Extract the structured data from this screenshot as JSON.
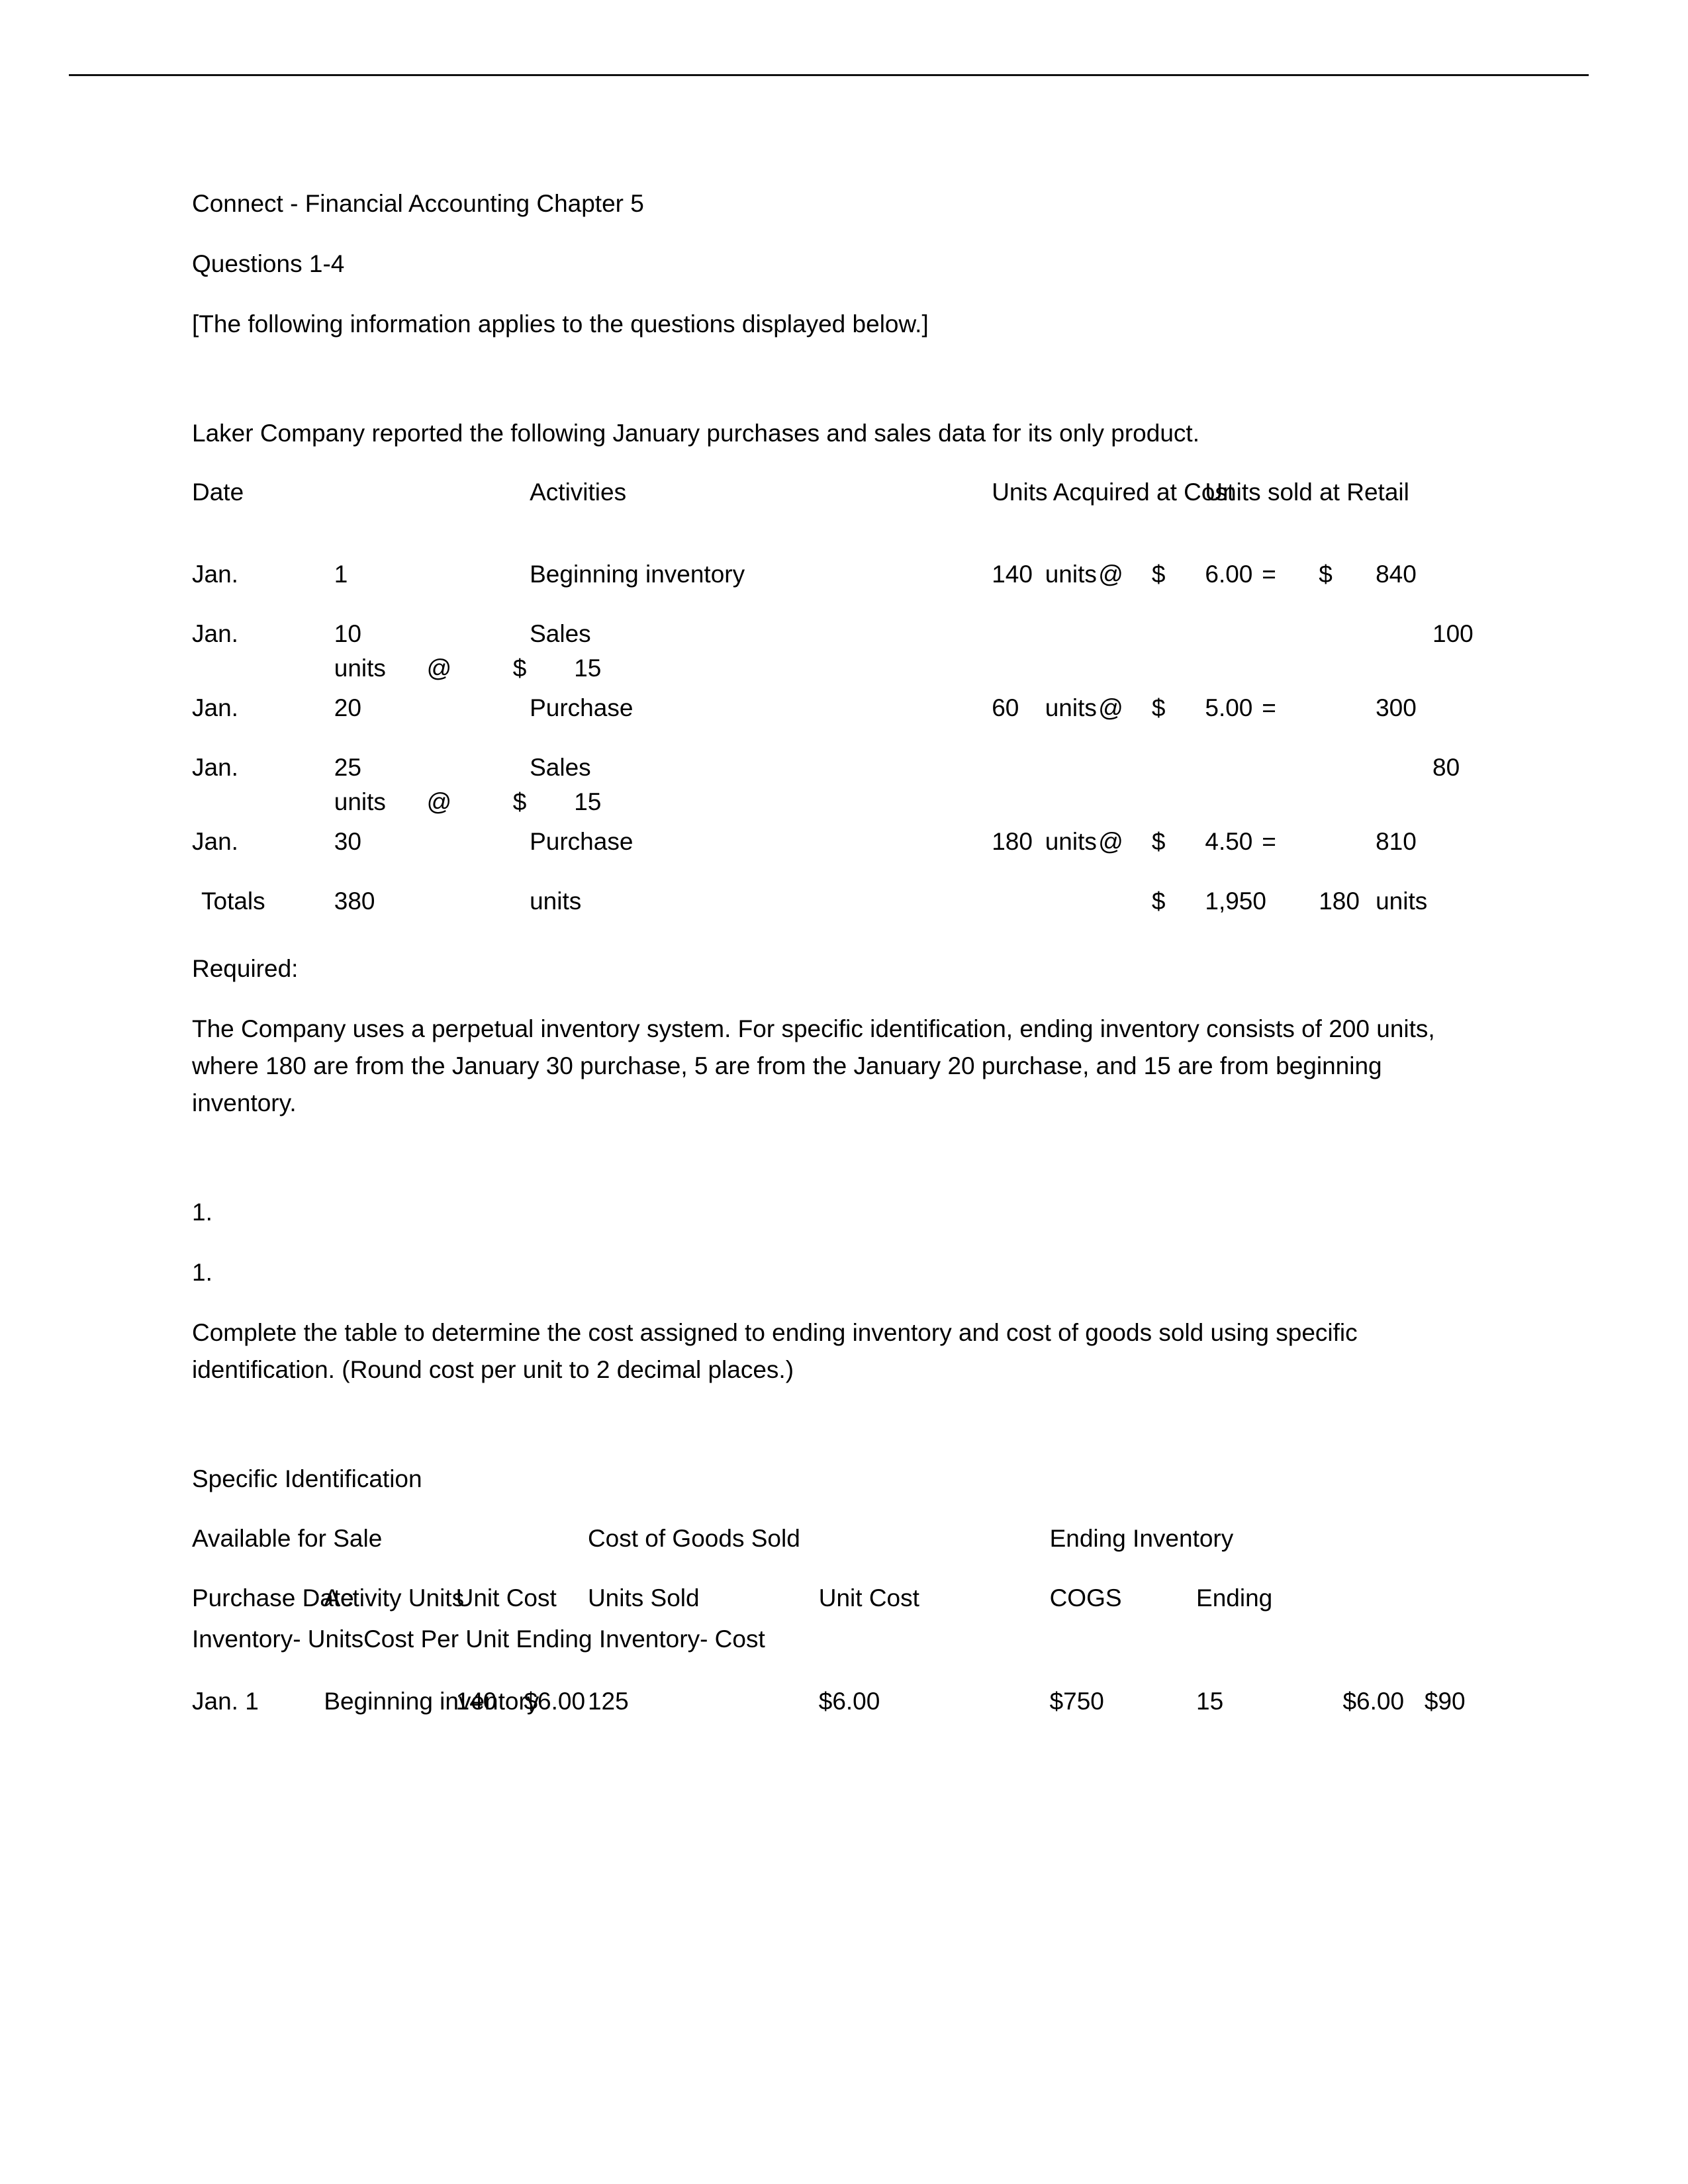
{
  "document": {
    "title": "Connect - Financial Accounting Chapter 5",
    "questions_range": "Questions 1-4",
    "applies_note": "[The following information applies to the questions displayed below.]",
    "intro": "Laker Company reported the following January purchases and sales data for its only product."
  },
  "purchases_table": {
    "headers": {
      "date": "Date",
      "activities": "Activities",
      "units_acquired": "Units Acquired at Cost",
      "units_sold": "Units sold at Retail"
    },
    "rows": [
      {
        "month": "Jan.",
        "day": "1",
        "activity": "Beginning inventory",
        "units": "140",
        "units_label": "units",
        "at": "@",
        "dollar": "$",
        "unit_cost": "6.00",
        "equals": "=",
        "dollar2": "$",
        "amount": "840",
        "retail": "",
        "wrap": ""
      },
      {
        "month": "Jan.",
        "day": "10",
        "activity": "Sales",
        "units": "",
        "units_label": "",
        "at": "",
        "dollar": "",
        "unit_cost": "",
        "equals": "",
        "dollar2": "",
        "amount": "",
        "retail": "100",
        "wrap": "units      @         $       15"
      },
      {
        "month": "Jan.",
        "day": "20",
        "activity": "Purchase",
        "units": "60",
        "units_label": "units",
        "at": "@",
        "dollar": "$",
        "unit_cost": "5.00",
        "equals": "=",
        "dollar2": "",
        "amount": "300",
        "retail": "",
        "wrap": ""
      },
      {
        "month": "Jan.",
        "day": "25",
        "activity": "Sales",
        "units": "",
        "units_label": "",
        "at": "",
        "dollar": "",
        "unit_cost": "",
        "equals": "",
        "dollar2": "",
        "amount": "",
        "retail": "80",
        "wrap": "units      @         $       15"
      },
      {
        "month": "Jan.",
        "day": "30",
        "activity": "Purchase",
        "units": "180",
        "units_label": "units",
        "at": "@",
        "dollar": "$",
        "unit_cost": "4.50",
        "equals": "=",
        "dollar2": "",
        "amount": "810",
        "retail": "",
        "wrap": ""
      }
    ],
    "totals": {
      "label": "Totals",
      "units": "380",
      "units_label": "units",
      "dollar": "$",
      "amount": "1,950",
      "sold_units": "180",
      "sold_units_label": "units"
    }
  },
  "required": {
    "heading": "Required:",
    "body": "The Company uses a perpetual inventory system. For specific identification, ending inventory consists of 200 units, where 180 are from the January 30 purchase, 5 are from the January 20 purchase, and 15 are from beginning inventory."
  },
  "question": {
    "num_outer": "1.",
    "num_inner": "1.",
    "prompt": "Complete the table to determine the cost assigned to ending inventory and cost of goods sold using specific identification. (Round cost per unit to 2 decimal places.)"
  },
  "specific_identification": {
    "title": "Specific Identification",
    "group_headers": {
      "available": "Available for Sale",
      "cogs": "Cost of Goods Sold",
      "ending": "Ending Inventory"
    },
    "column_headers": {
      "purchase_date": "Purchase Date",
      "activity": "Activity",
      "units": "Units",
      "unit_cost": "Unit Cost",
      "units_sold": "Units Sold",
      "unit_cost_2": "Unit Cost",
      "cogs": "COGS",
      "ending": "Ending"
    },
    "column_headers_wrap": "Inventory- UnitsCost Per Unit    Ending Inventory- Cost",
    "rows": [
      {
        "purchase_date": "Jan. 1",
        "activity": "Beginning inventory",
        "units": "140",
        "unit_cost": "$6.00",
        "units_sold": "125",
        "unit_cost_2": "$6.00",
        "cogs": "$750",
        "ending_units": "15",
        "ending_cost_per_unit": "$6.00",
        "ending_cost": "$90"
      }
    ]
  }
}
